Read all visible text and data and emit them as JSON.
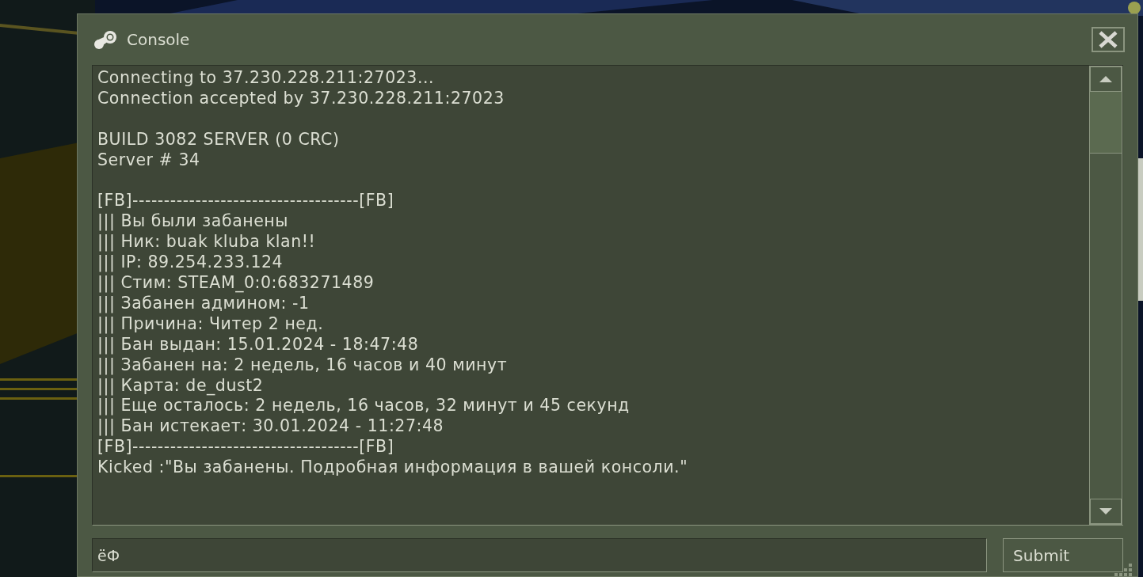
{
  "window": {
    "title": "Console"
  },
  "log": {
    "blocks": [
      {
        "lines": [
          "Connecting to 37.230.228.211:27023...",
          "Connection accepted by 37.230.228.211:27023"
        ]
      },
      {
        "lines": [
          "BUILD 3082 SERVER (0 CRC)",
          "Server # 34"
        ]
      },
      {
        "lines": [
          "[FB]------------------------------------[FB]",
          "||| Вы были забанены",
          "||| Ник: buak kluba klan!!",
          "||| IP: 89.254.233.124",
          "||| Стим: STEAM_0:0:683271489",
          "||| Забанен админом: -1",
          "||| Причина: Читер 2 нед.",
          "||| Бан выдан: 15.01.2024 - 18:47:48",
          "||| Забанен на: 2 недель, 16 часов и 40 минут",
          "||| Карта: de_dust2",
          "||| Еще осталось: 2 недель, 16 часов, 32 минут и 45 секунд",
          "||| Бан истекает: 30.01.2024 - 11:27:48",
          "[FB]------------------------------------[FB]",
          "Kicked :\"Вы забанены. Подробная информация в вашей консоли.\""
        ]
      }
    ]
  },
  "input": {
    "value": "ёФ"
  },
  "submit": {
    "label": "Submit"
  }
}
